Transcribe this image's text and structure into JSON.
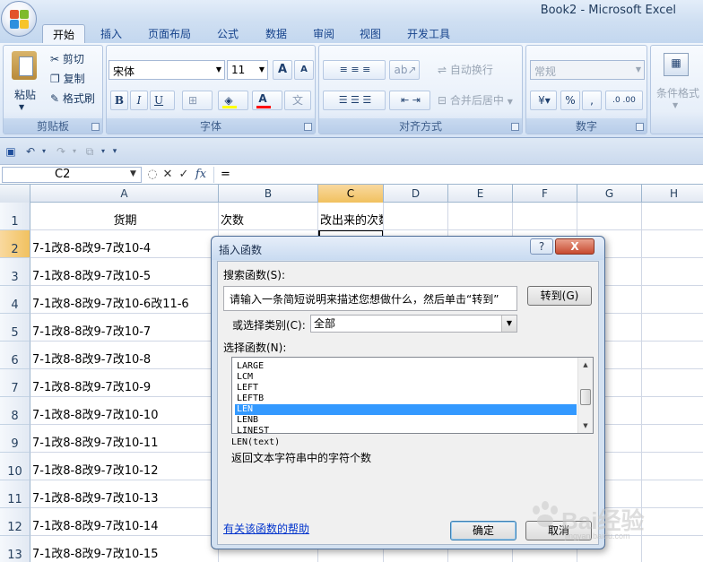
{
  "window": {
    "title": "Book2 - Microsoft Excel"
  },
  "tabs": [
    "开始",
    "插入",
    "页面布局",
    "公式",
    "数据",
    "审阅",
    "视图",
    "开发工具"
  ],
  "ribbon": {
    "clipboard": {
      "paste": "粘贴",
      "cut": "剪切",
      "copy": "复制",
      "format_painter": "格式刷",
      "label": "剪贴板"
    },
    "font": {
      "name": "宋体",
      "size": "11",
      "grow": "A",
      "shrink": "A",
      "bold": "B",
      "italic": "I",
      "underline": "U",
      "label": "字体"
    },
    "alignment": {
      "wrap": "自动换行",
      "merge": "合并后居中",
      "label": "对齐方式"
    },
    "number": {
      "format": "常规",
      "percent": "%",
      "label": "数字"
    },
    "styles": {
      "conditional": "条件格式"
    }
  },
  "formula_bar": {
    "name_box": "C2",
    "equals": "=",
    "fx": "fx"
  },
  "columns": [
    "A",
    "B",
    "C",
    "D",
    "E",
    "F",
    "G",
    "H"
  ],
  "rows": [
    "1",
    "2",
    "3",
    "4",
    "5",
    "6",
    "7",
    "8",
    "9",
    "10",
    "11",
    "12",
    "13"
  ],
  "cells": {
    "A1": "货期",
    "B1": "次数",
    "C1": "改出来的次数",
    "A2": "7-1改8-8改9-7改10-4",
    "A3": "7-1改8-8改9-7改10-5",
    "A4": "7-1改8-8改9-7改10-6改11-6",
    "A5": "7-1改8-8改9-7改10-7",
    "A6": "7-1改8-8改9-7改10-8",
    "A7": "7-1改8-8改9-7改10-9",
    "A8": "7-1改8-8改9-7改10-10",
    "A9": "7-1改8-8改9-7改10-11",
    "A10": "7-1改8-8改9-7改10-12",
    "A11": "7-1改8-8改9-7改10-13",
    "A12": "7-1改8-8改9-7改10-14",
    "A13": "7-1改8-8改9-7改10-15"
  },
  "dialog": {
    "title": "插入函数",
    "help_btn": "?",
    "close_btn": "X",
    "search_label": "搜索函数(S):",
    "search_text": "请输入一条简短说明来描述您想做什么，然后单击“转到”",
    "go_button": "转到(G)",
    "category_label": "或选择类别(C):",
    "category_value": "全部",
    "select_label": "选择函数(N):",
    "functions": [
      "LARGE",
      "LCM",
      "LEFT",
      "LEFTB",
      "LEN",
      "LENB",
      "LINEST"
    ],
    "selected_function": "LEN",
    "signature": "LEN(text)",
    "description": "返回文本字符串中的字符个数",
    "help_link": "有关该函数的帮助",
    "ok_button": "确定",
    "cancel_button": "取消"
  },
  "watermark": {
    "text": "Bai经验",
    "domain": "jingyan.baidu.com"
  },
  "colors": {
    "accent": "#3399ff",
    "selected_header": "#f1c15f",
    "ribbon": "#dfe9f5",
    "link": "#0033cc"
  }
}
